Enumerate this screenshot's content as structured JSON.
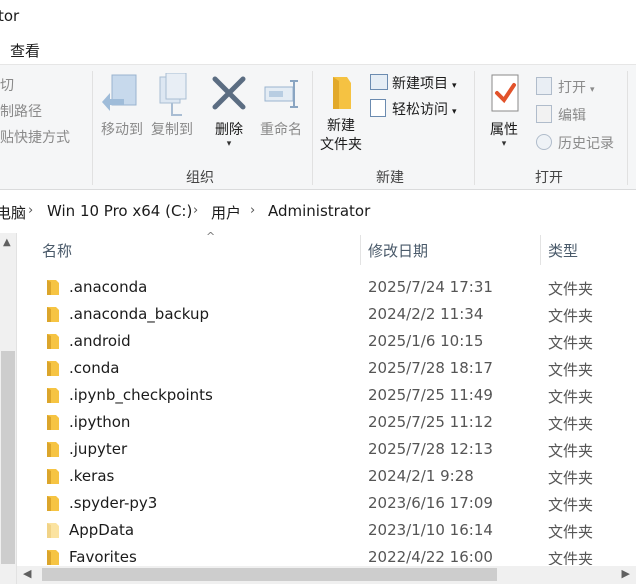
{
  "window": {
    "title": "tor"
  },
  "menubar": {
    "view_tab": "查看"
  },
  "ribbon": {
    "clipboard": {
      "cut": "剪切",
      "copy_path": "复制路径",
      "paste_shortcut": "粘贴快捷方式"
    },
    "organize": {
      "move_to": "移动到",
      "copy_to": "复制到",
      "delete": "删除",
      "rename": "重命名",
      "group_label": "组织"
    },
    "new": {
      "new_folder_line1": "新建",
      "new_folder_line2": "文件夹",
      "new_item": "新建项目",
      "easy_access": "轻松访问",
      "group_label": "新建"
    },
    "open": {
      "properties": "属性",
      "open": "打开",
      "edit": "编辑",
      "history": "历史记录",
      "group_label": "打开"
    }
  },
  "breadcrumb": {
    "items": [
      "电脑",
      "Win 10 Pro x64 (C:)",
      "用户",
      "Administrator"
    ]
  },
  "columns": {
    "name": "名称",
    "modified": "修改日期",
    "type": "类型"
  },
  "files": [
    {
      "name": ".anaconda",
      "modified": "2025/7/24 17:31",
      "type": "文件夹"
    },
    {
      "name": ".anaconda_backup",
      "modified": "2024/2/2 11:34",
      "type": "文件夹"
    },
    {
      "name": ".android",
      "modified": "2025/1/6 10:15",
      "type": "文件夹"
    },
    {
      "name": ".conda",
      "modified": "2025/7/28 18:17",
      "type": "文件夹"
    },
    {
      "name": ".ipynb_checkpoints",
      "modified": "2025/7/25 11:49",
      "type": "文件夹"
    },
    {
      "name": ".ipython",
      "modified": "2025/7/25 11:12",
      "type": "文件夹"
    },
    {
      "name": ".jupyter",
      "modified": "2025/7/28 12:13",
      "type": "文件夹"
    },
    {
      "name": ".keras",
      "modified": "2024/2/1 9:28",
      "type": "文件夹"
    },
    {
      "name": ".spyder-py3",
      "modified": "2023/6/16 17:09",
      "type": "文件夹"
    },
    {
      "name": "AppData",
      "modified": "2023/1/10 16:14",
      "type": "文件夹"
    },
    {
      "name": "Favorites",
      "modified": "2022/4/22 16:00",
      "type": "文件夹"
    }
  ],
  "colors": {
    "folder": "#f6c443",
    "folder_hidden": "#fbe3a1",
    "accent": "#1a6fc2"
  }
}
